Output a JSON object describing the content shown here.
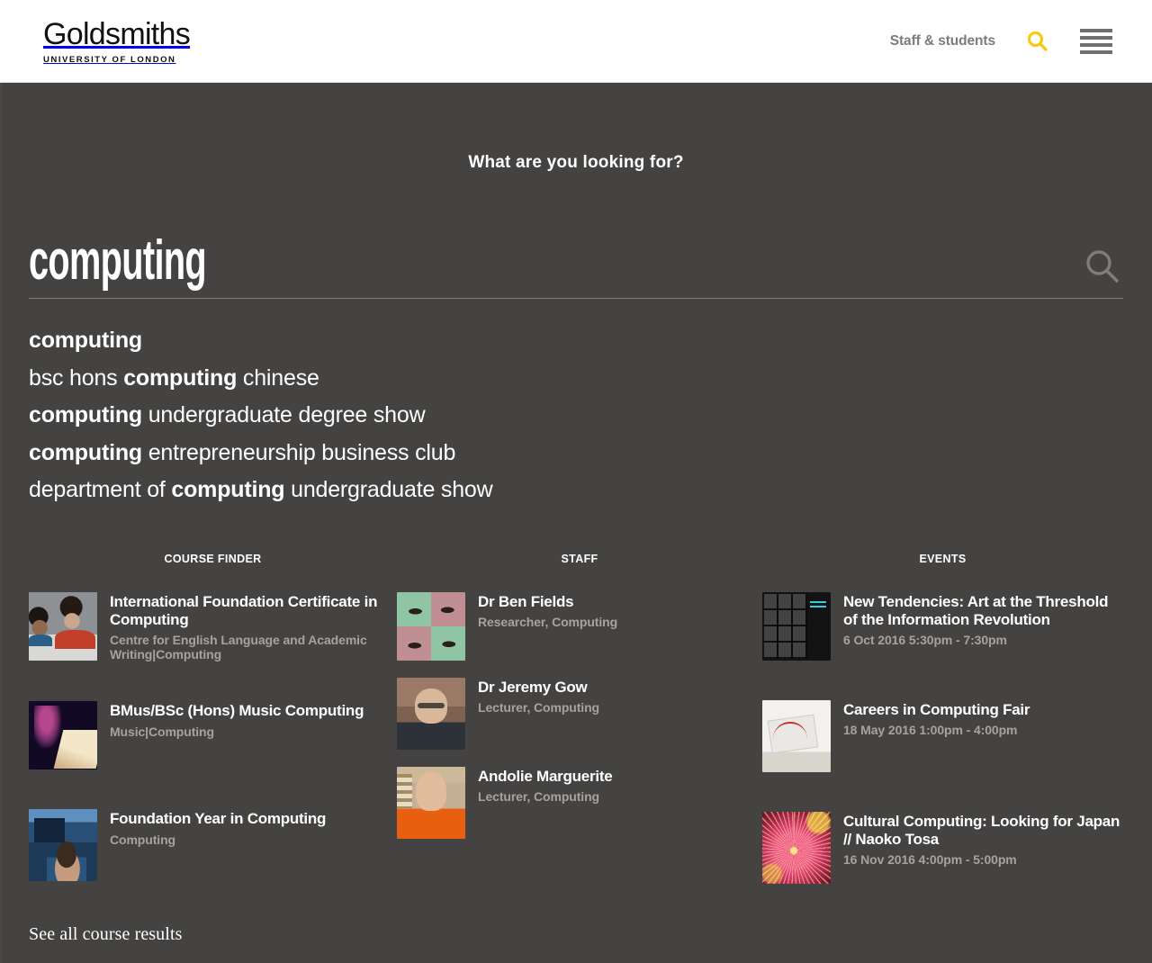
{
  "header": {
    "logo_word": "Goldsmiths",
    "logo_sub": "UNIVERSITY OF LONDON",
    "staff_students_label": "Staff & students",
    "search_icon": "search-icon",
    "menu_icon": "hamburger-menu-icon",
    "accent_color": "#F9C916",
    "icon_grey": "#6F6F6F",
    "staff_link_color": "#7C7C7C"
  },
  "overlay": {
    "background_color": "#444342",
    "prompt": "What are you looking for?"
  },
  "search": {
    "value": "computing",
    "placeholder": "",
    "submit_icon": "search-icon"
  },
  "suggestions": [
    {
      "pre": "",
      "bold": "computing",
      "post": ""
    },
    {
      "pre": "bsc hons ",
      "bold": "computing",
      "post": " chinese"
    },
    {
      "pre": "",
      "bold": "computing",
      "post": " undergraduate degree show"
    },
    {
      "pre": "",
      "bold": "computing",
      "post": " entrepreneurship business club"
    },
    {
      "pre": "department of ",
      "bold": "computing",
      "post": " undergraduate show"
    }
  ],
  "columns": {
    "course_finder": {
      "heading": "COURSE FINDER",
      "items": [
        {
          "title_pre": "International Foundation Certificate in ",
          "title_bold": "Computing",
          "meta": "Centre for English Language and Academic Writing|Computing",
          "thumb": "classroom-students-thumbnail"
        },
        {
          "title_pre": "BMus/BSc (Hons) Music ",
          "title_bold": "Computing",
          "meta": "Music|Computing",
          "thumb": "music-laptop-thumbnail"
        },
        {
          "title_pre": "Foundation Year in ",
          "title_bold": "Computing",
          "meta": "Computing",
          "thumb": "computer-lab-thumbnail"
        }
      ],
      "see_all_label": "See all course results"
    },
    "staff": {
      "heading": "STAFF",
      "items": [
        {
          "title_pre": "Dr Ben Fields",
          "title_bold": "",
          "meta": "Researcher, Computing",
          "thumb": "duotone-eyes-portrait-thumbnail"
        },
        {
          "title_pre": "Dr Jeremy Gow",
          "title_bold": "",
          "meta": "Lecturer, Computing",
          "thumb": "jeremy-gow-portrait-thumbnail"
        },
        {
          "title_pre": "Andolie Marguerite",
          "title_bold": "",
          "meta": "Lecturer, Computing",
          "thumb": "andolie-marguerite-portrait-thumbnail"
        }
      ]
    },
    "events": {
      "heading": "EVENTS",
      "items": [
        {
          "title_pre": "New Tendencies: Art at the Threshold of the Information Revolution",
          "title_bold": "",
          "meta": "6 Oct 2016 5:30pm - 7:30pm",
          "thumb": "new-tendencies-poster-thumbnail"
        },
        {
          "title_pre": "Careers in ",
          "title_bold": "Computing",
          "title_post": " Fair",
          "meta": "18 May 2016 1:00pm - 4:00pm",
          "thumb": "circuit-board-thumbnail"
        },
        {
          "title_pre": "Cultural ",
          "title_bold": "Computing",
          "title_post": ": Looking for Japan // Naoko Tosa",
          "meta": "16 Nov 2016 4:00pm - 5:00pm",
          "thumb": "naoko-tosa-bloom-thumbnail"
        }
      ]
    }
  }
}
